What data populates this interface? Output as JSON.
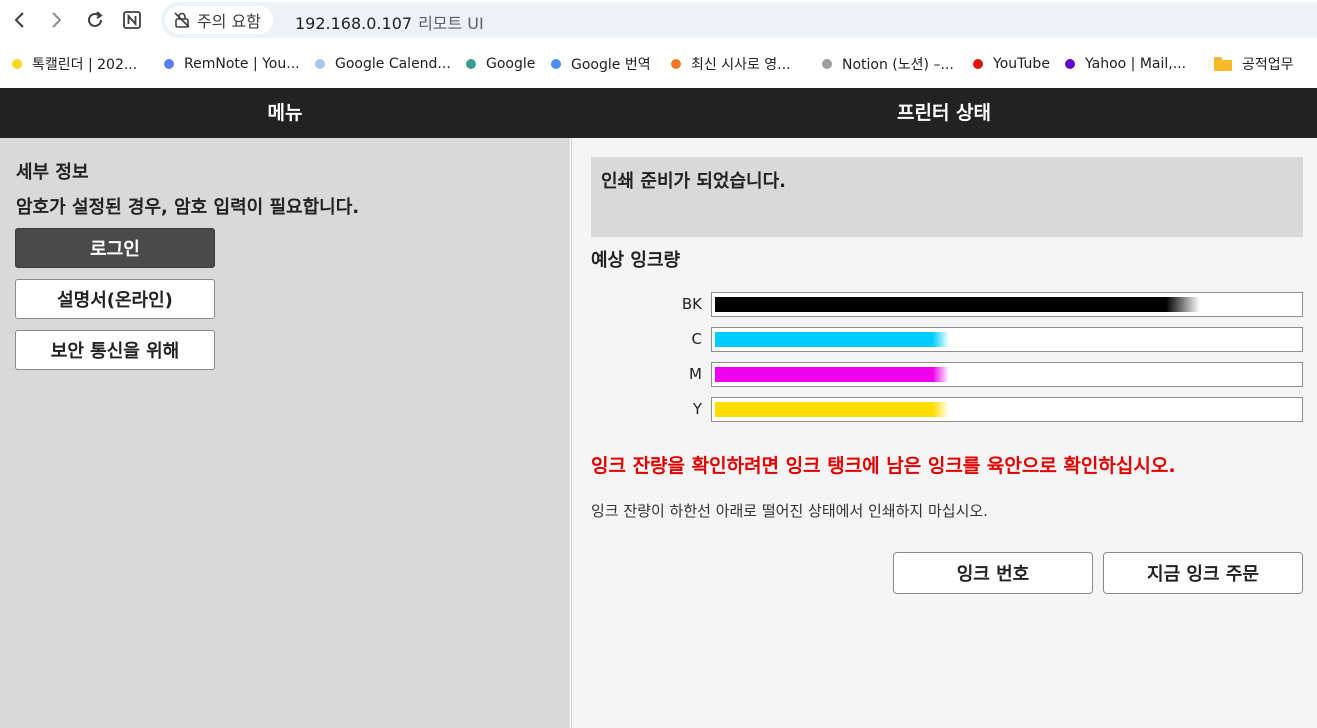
{
  "browser": {
    "security_label": "주의 요함",
    "url_host": "192.168.0.107",
    "url_path": "리모트 UI"
  },
  "bookmarks": [
    {
      "label": "톡캘린더 | 202...",
      "color": "#f9d71c"
    },
    {
      "label": "RemNote | You...",
      "color": "#5b7cf0"
    },
    {
      "label": "Google Calend...",
      "color": "#aac4f0"
    },
    {
      "label": "Google",
      "color": "#3a9e8f"
    },
    {
      "label": "Google 번역",
      "color": "#4c8df6"
    },
    {
      "label": "최신 시사로 영...",
      "color": "#f47b20"
    },
    {
      "label": "Notion (노션) –...",
      "color": "#9e9e9e"
    },
    {
      "label": "YouTube",
      "color": "#e8120c"
    },
    {
      "label": "Yahoo | Mail,...",
      "color": "#6001d2"
    },
    {
      "label": "공적업무",
      "color": "#f9b928"
    }
  ],
  "header": {
    "menu_title": "메뉴",
    "status_title": "프린터 상태"
  },
  "menu": {
    "section_title": "세부 정보",
    "password_note": "암호가 설정된 경우, 암호 입력이 필요합니다.",
    "login_label": "로그인",
    "manual_label": "설명서(온라인)",
    "security_label": "보안 통신을 위해"
  },
  "status": {
    "message": "인쇄 준비가 되었습니다.",
    "ink_title": "예상 잉크량",
    "inks": [
      {
        "name": "BK",
        "level": 0.83,
        "color": "#000000"
      },
      {
        "name": "C",
        "level": 0.4,
        "color": "#00ccff"
      },
      {
        "name": "M",
        "level": 0.4,
        "color": "#ee00ee"
      },
      {
        "name": "Y",
        "level": 0.4,
        "color": "#ffdd00"
      }
    ],
    "warning": "잉크 잔량을 확인하려면 잉크 탱크에 남은 잉크를 육안으로 확인하십시오.",
    "caution": "잉크 잔량이 하한선 아래로 떨어진 상태에서 인쇄하지 마십시오.",
    "ink_number_label": "잉크 번호",
    "order_label": "지금 잉크 주문"
  }
}
